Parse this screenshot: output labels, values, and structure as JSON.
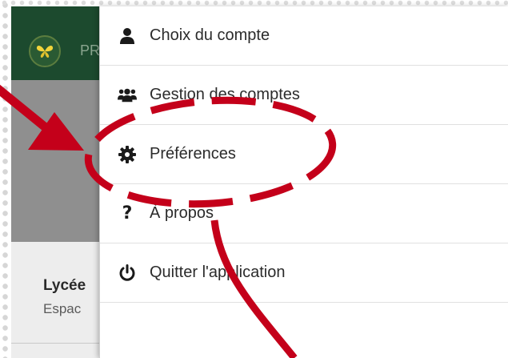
{
  "app": {
    "title_fragment": "PR",
    "school_name_fragment": "Lycée",
    "school_sub_fragment": "Espac"
  },
  "menu": {
    "items": [
      {
        "label": "Choix du compte",
        "icon": "user-icon"
      },
      {
        "label": "Gestion des comptes",
        "icon": "users-icon"
      },
      {
        "label": "Préférences",
        "icon": "gear-icon"
      },
      {
        "label": "À propos",
        "icon": "question-icon"
      },
      {
        "label": "Quitter l'application",
        "icon": "power-icon"
      }
    ]
  },
  "annotation": {
    "color": "#c4001a"
  }
}
